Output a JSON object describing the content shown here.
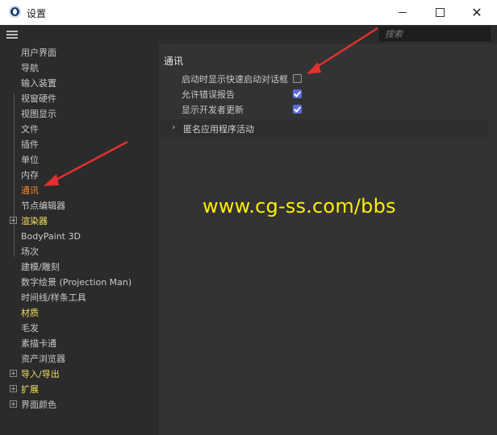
{
  "window": {
    "title": "设置"
  },
  "search": {
    "placeholder": "搜索"
  },
  "sidebar": {
    "items": [
      {
        "label": "用户界面"
      },
      {
        "label": "导航"
      },
      {
        "label": "输入装置"
      },
      {
        "label": "视窗硬件"
      },
      {
        "label": "视图显示"
      },
      {
        "label": "文件"
      },
      {
        "label": "插件"
      },
      {
        "label": "单位"
      },
      {
        "label": "内存"
      },
      {
        "label": "通讯",
        "active": true
      },
      {
        "label": "节点编辑器"
      },
      {
        "label": "渲染器",
        "expandable": true
      },
      {
        "label": "BodyPaint 3D"
      },
      {
        "label": "场次"
      },
      {
        "label": "建模/雕刻"
      },
      {
        "label": "数字绘景 (Projection Man)"
      },
      {
        "label": "时间线/样条工具"
      },
      {
        "label": "材质"
      },
      {
        "label": "毛发"
      },
      {
        "label": "素描卡通"
      },
      {
        "label": "资产浏览器"
      },
      {
        "label": "导入/导出",
        "expandable": true
      },
      {
        "label": "扩展",
        "expandable": true
      },
      {
        "label": "界面颜色",
        "expandable": true
      }
    ]
  },
  "content": {
    "section_title": "通讯",
    "options": [
      {
        "label": "启动时显示快速启动对话框",
        "checked": false
      },
      {
        "label": "允许错误报告",
        "checked": true
      },
      {
        "label": "显示开发者更新",
        "checked": true
      }
    ],
    "collapsible": {
      "label": "匿名应用程序活动",
      "expanded": false
    },
    "watermark": "www.cg-ss.com/bbs"
  },
  "colors": {
    "active_item": "#ff8a2a",
    "group_item": "#f0e060",
    "checkbox_checked": "#5a6fd6",
    "watermark": "#ffee00",
    "annotation_arrow": "#e23030"
  },
  "icons": {
    "app": "cinema4d-icon",
    "menu": "hamburger-menu-icon",
    "minimize": "minimize-icon",
    "maximize": "maximize-icon",
    "close": "close-icon",
    "chevron": "chevron-right-icon"
  }
}
